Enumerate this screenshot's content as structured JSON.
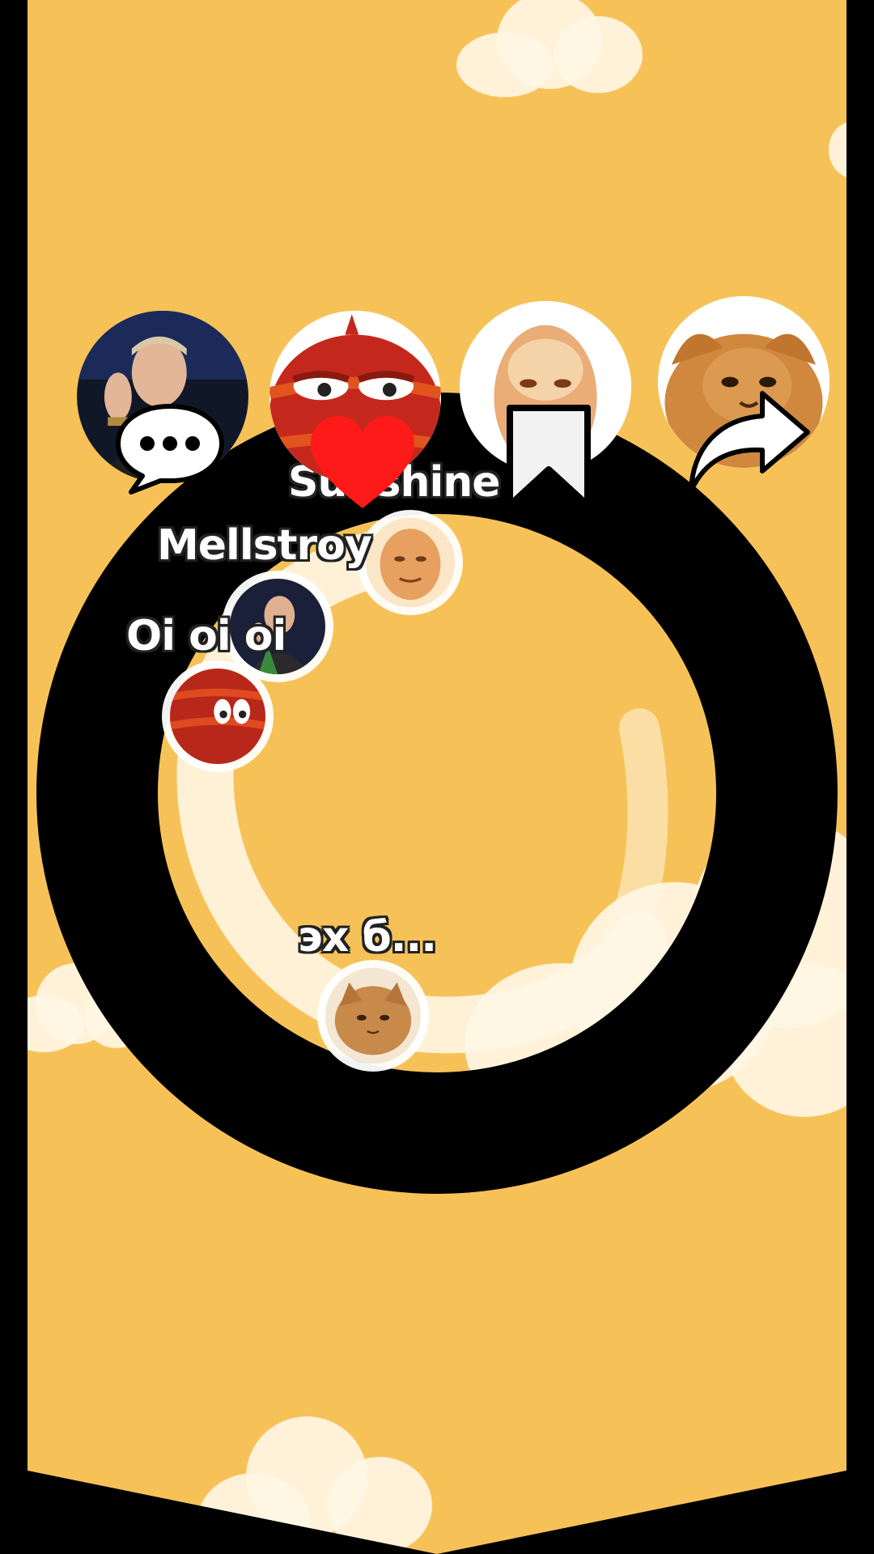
{
  "balls": [
    {
      "id": "sunshine",
      "label": "Sunshine",
      "avatar": "glowing-face"
    },
    {
      "id": "mellstroy",
      "label": "Mellstroy",
      "avatar": "man-portrait"
    },
    {
      "id": "oioioi",
      "label": "Oi oi oi",
      "avatar": "red-creature"
    },
    {
      "id": "eh",
      "label": "эх б...",
      "avatar": "cat-face"
    }
  ],
  "avatars": [
    {
      "id": "mellstroy",
      "avatar": "man-portrait"
    },
    {
      "id": "oioioi",
      "avatar": "red-creature"
    },
    {
      "id": "sunshine",
      "avatar": "glowing-face"
    },
    {
      "id": "eh",
      "avatar": "persian-cat"
    }
  ],
  "actions": {
    "comment": "comment-icon",
    "like": "heart-icon",
    "bookmark": "bookmark-icon",
    "share": "share-icon"
  },
  "colors": {
    "background": "#f6c258",
    "ring": "#000000",
    "track": "#fff6e4",
    "like": "#ff1a1a",
    "label_text": "#ffffff"
  }
}
